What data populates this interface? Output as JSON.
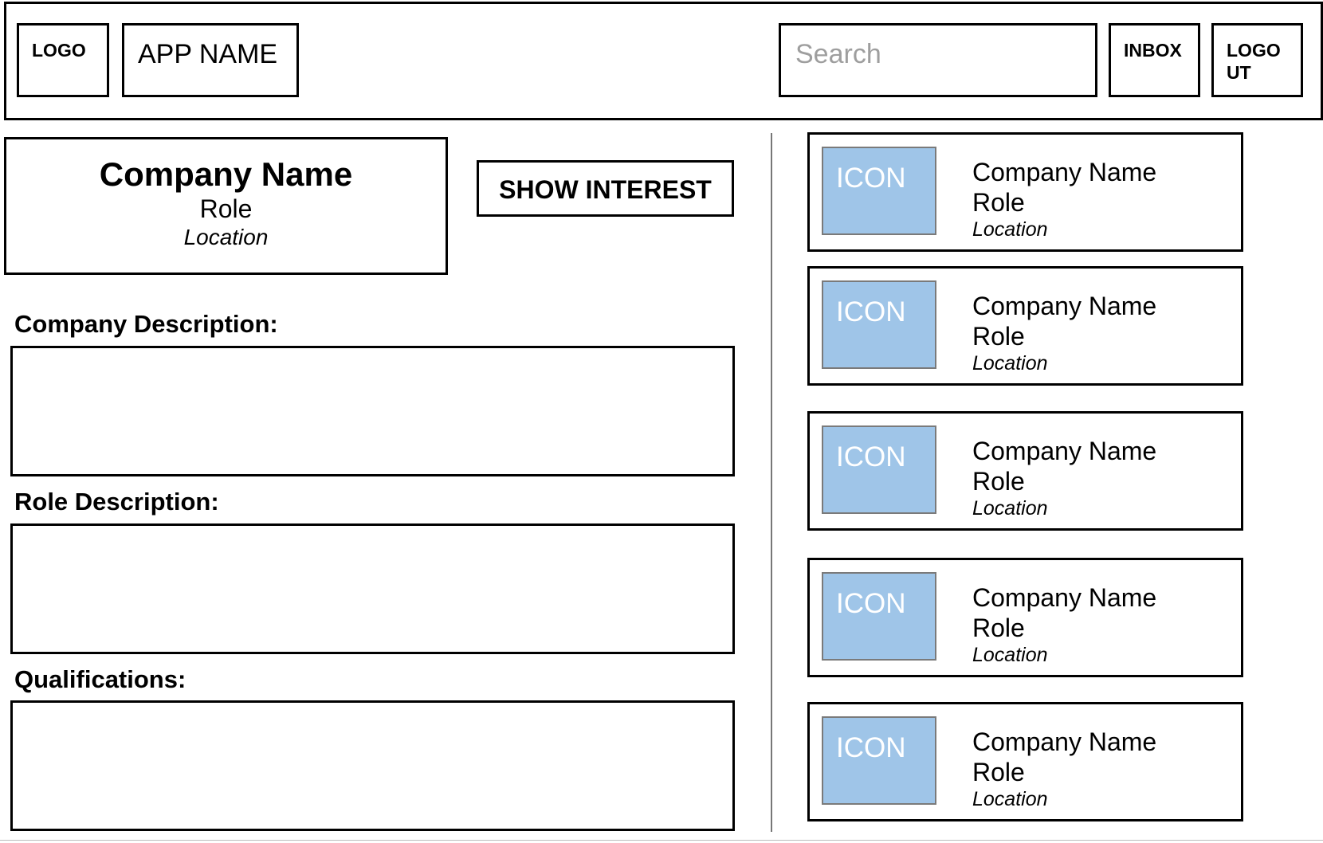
{
  "header": {
    "logo": "LOGO",
    "app_name": "APP NAME",
    "search_placeholder": "Search",
    "inbox": "INBOX",
    "logout": "LOGO UT"
  },
  "job": {
    "company": "Company Name",
    "role": "Role",
    "location": "Location",
    "show_interest": "SHOW INTEREST"
  },
  "sections": {
    "company_description": "Company Description:",
    "role_description": "Role Description:",
    "qualifications": "Qualifications:"
  },
  "listings": [
    {
      "icon": "ICON",
      "company": "Company Name",
      "role": "Role",
      "location": "Location"
    },
    {
      "icon": "ICON",
      "company": "Company Name",
      "role": "Role",
      "location": "Location"
    },
    {
      "icon": "ICON",
      "company": "Company Name",
      "role": "Role",
      "location": "Location"
    },
    {
      "icon": "ICON",
      "company": "Company Name",
      "role": "Role",
      "location": "Location"
    },
    {
      "icon": "ICON",
      "company": "Company Name",
      "role": "Role",
      "location": "Location"
    }
  ],
  "colors": {
    "icon_fill": "#9fc5e8",
    "placeholder_text": "#9e9e9e",
    "border": "#000000"
  }
}
